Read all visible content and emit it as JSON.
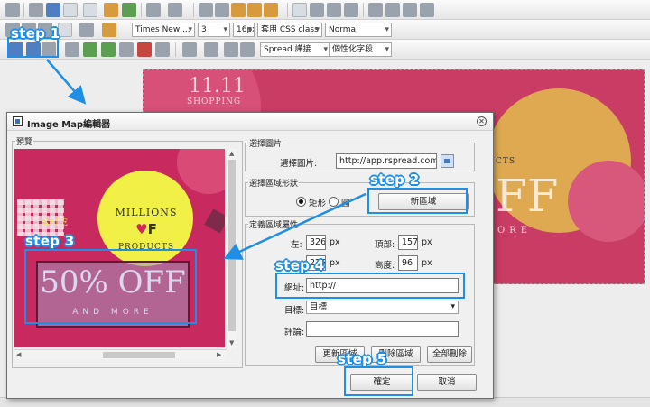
{
  "editor": {
    "font_name": "Times New ...",
    "font_size_index": "3",
    "font_size_px": "16px",
    "css_class": "套用 CSS class",
    "format": "Normal",
    "spread_link": "Spread 譁接",
    "personal_field": "個性化字段",
    "statusbar_text": ""
  },
  "dialog": {
    "title": "Image Map編輯器",
    "preview_label": "預覽",
    "preview_image": {
      "millions": "MILLIONS",
      "of_text": "F",
      "products": "PRODUCTS",
      "sale": "SALE",
      "offer": "50% OFF",
      "and_more": "AND MORE"
    },
    "select_image": {
      "group_label": "選擇圖片",
      "label": "選擇圖片:",
      "value": "http://app.rspread.com/Sp"
    },
    "shape": {
      "group_label": "選擇區域形狀",
      "rect_label": "矩形",
      "circle_label": "圓",
      "selected": "rect",
      "new_area_button": "新區域"
    },
    "properties": {
      "group_label": "定義區域屬性",
      "left_label": "左:",
      "left_value": "326",
      "top_label": "頂部:",
      "top_value": "157",
      "width_label": "寬度:",
      "width_value": "225",
      "height_label": "高度:",
      "height_value": "96",
      "unit": "px",
      "url_label": "網址:",
      "url_value": "http://",
      "target_label": "目標:",
      "target_value": "目標",
      "comment_label": "評論:",
      "comment_value": "",
      "update_button": "更新區域",
      "delete_button": "刪除區域",
      "delete_all_button": "全部刪除"
    },
    "ok_button": "確定",
    "cancel_button": "取消"
  },
  "annotations": {
    "step1": "step 1",
    "step2": "step 2",
    "step3": "step 3",
    "step4": "step 4",
    "step5": "step 5",
    "color": "#1f8fe6"
  }
}
